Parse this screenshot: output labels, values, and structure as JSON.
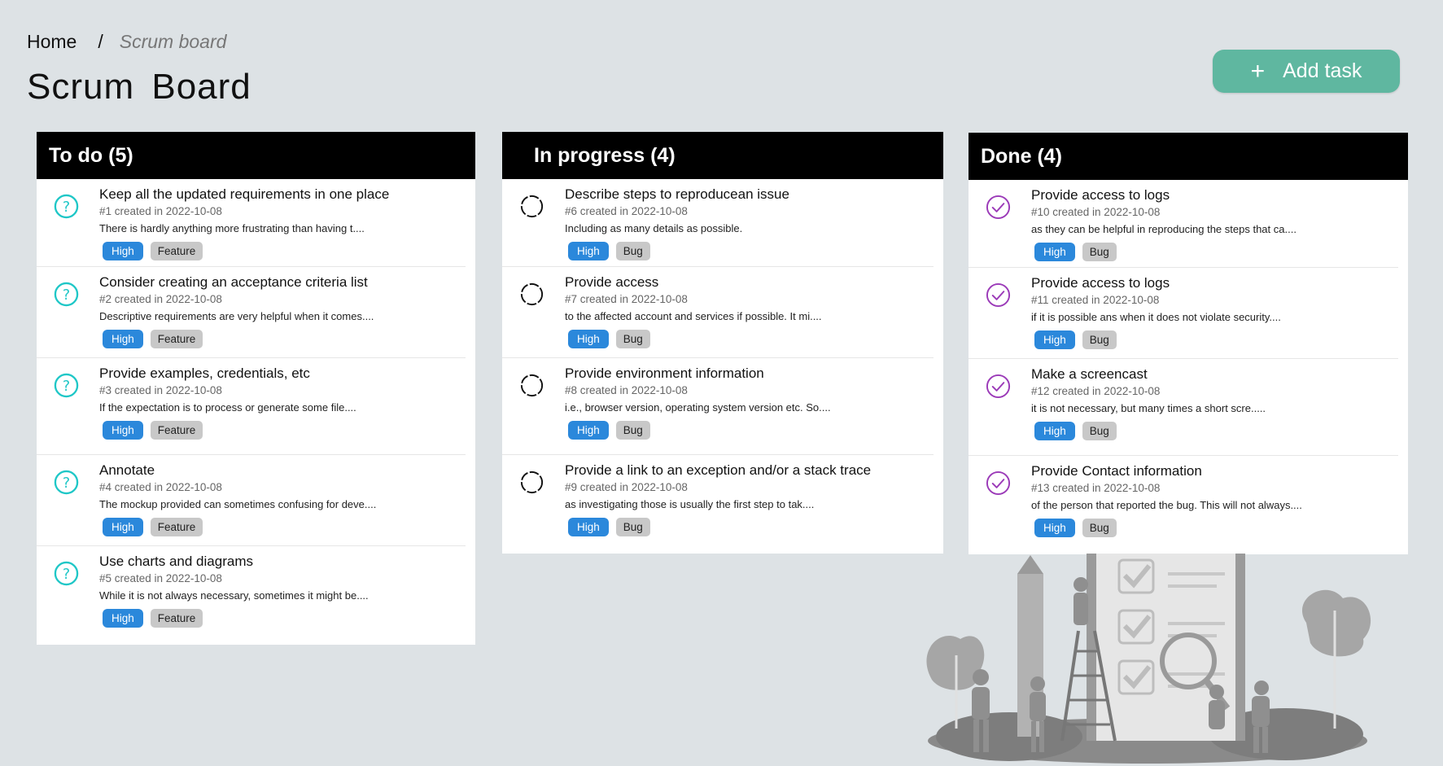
{
  "breadcrumb": {
    "home": "Home",
    "separator": "/",
    "current": "Scrum board"
  },
  "page_title": "Scrum  Board",
  "add_task_label": "Add task",
  "colors": {
    "accent": "#5fb7a0",
    "high_tag": "#2b88db",
    "todo_icon": "#1fc7c7",
    "done_icon": "#9b3ab8",
    "header_bg": "#000000"
  },
  "columns": [
    {
      "title": "To do (5)",
      "icon": "question-circle-icon",
      "tasks": [
        {
          "title": "Keep all the updated requirements in one place",
          "meta": "#1 created in 2022-10-08",
          "desc": "There is hardly  anything more frustrating  than having t....",
          "priority": "High",
          "type": "Feature"
        },
        {
          "title": "Consider creating an acceptance criteria  list",
          "meta": "#2 created in 2022-10-08",
          "desc": "Descriptive requirements are very helpful  when it comes....",
          "priority": "High",
          "type": "Feature"
        },
        {
          "title": "Provide examples, credentials, etc",
          "meta": "#3 created in 2022-10-08",
          "desc": "If the expectation  is to process or generate some file....",
          "priority": "High",
          "type": "Feature"
        },
        {
          "title": "Annotate",
          "meta": "#4 created in 2022-10-08",
          "desc": "The mockup  provided can sometimes confusing for deve....",
          "priority": "High",
          "type": "Feature"
        },
        {
          "title": "Use charts and diagrams",
          "meta": "#5 created in 2022-10-08",
          "desc": "While it is not always necessary, sometimes it might be....",
          "priority": "High",
          "type": "Feature"
        }
      ]
    },
    {
      "title": "In progress (4)",
      "icon": "progress-circle-icon",
      "tasks": [
        {
          "title": "Describe steps to reproducean issue",
          "meta": "#6 created in 2022-10-08",
          "desc": "Including  as many details as possible.",
          "priority": "High",
          "type": "Bug"
        },
        {
          "title": "Provide access",
          "meta": "#7 created in 2022-10-08",
          "desc": "to the affected  account and services if possible. It mi....",
          "priority": "High",
          "type": "Bug"
        },
        {
          "title": "Provide environment information",
          "meta": "#8 created in 2022-10-08",
          "desc": "i.e., browser version, operating system version etc. So....",
          "priority": "High",
          "type": "Bug"
        },
        {
          "title": "Provide a link to an exception  and/or a stack trace",
          "meta": "#9 created in 2022-10-08",
          "desc": "as investigating those is usually the first step to tak....",
          "priority": "High",
          "type": "Bug"
        }
      ]
    },
    {
      "title": "Done (4)",
      "icon": "check-circle-icon",
      "tasks": [
        {
          "title": "Provide access to logs",
          "meta": "#10 created in 2022-10-08",
          "desc": "as  they can  be helpful in reproducing the steps that ca....",
          "priority": "High",
          "type": "Bug"
        },
        {
          "title": "Provide access to logs",
          "meta": "#11 created in 2022-10-08",
          "desc": "if it is possible ans when it does not violate  security....",
          "priority": "High",
          "type": "Bug"
        },
        {
          "title": "Make a screencast",
          "meta": "#12 created in 2022-10-08",
          "desc": "it  is not necessary, but many times a short scre.....",
          "priority": "High",
          "type": "Bug"
        },
        {
          "title": "Provide Contact information",
          "meta": "#13 created in 2022-10-08",
          "desc": "of the person that reported the bug. This will  not always....",
          "priority": "High",
          "type": "Bug"
        }
      ]
    }
  ]
}
